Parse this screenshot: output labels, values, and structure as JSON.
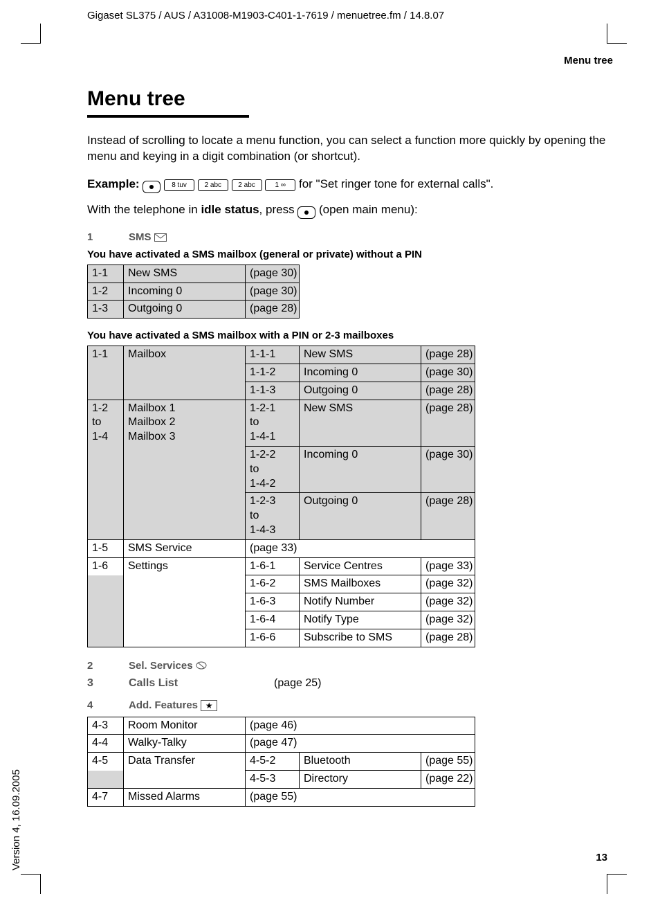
{
  "header": {
    "source_line": "Gigaset SL375 / AUS / A31008-M1903-C401-1-7619 / menuetree.fm / 14.8.07",
    "top_right": "Menu tree",
    "title": "Menu tree"
  },
  "intro": {
    "line1": "Instead of scrolling to locate a menu function, you can select a function more quickly by opening the menu and keying in a digit combination (or shortcut).",
    "example_label": "Example:",
    "key1": "8 tuv",
    "key2": "2 abc",
    "key3": "2 abc",
    "key4": "1 ∞",
    "example_tail": " for \"Set ringer tone for external calls\".",
    "idle_pre": "With the telephone in ",
    "idle_bold": "idle status",
    "idle_post": ", press ",
    "idle_tail": " (open main menu):"
  },
  "sections": {
    "s1": {
      "num": "1",
      "label": "SMS"
    },
    "s2": {
      "num": "2",
      "label": "Sel. Services"
    },
    "s3": {
      "num": "3",
      "label": "Calls List",
      "page": "(page 25)"
    },
    "s4": {
      "num": "4",
      "label": "Add. Features"
    }
  },
  "notes": {
    "no_pin": "You have activated a SMS mailbox (general or private) without a PIN",
    "with_pin": "You have activated a SMS mailbox with a PIN or 2-3 mailboxes"
  },
  "tableA": {
    "r1": {
      "c1": "1-1",
      "c2": "New SMS",
      "c3": "(page 30)"
    },
    "r2": {
      "c1": "1-2",
      "c2": "Incoming 0",
      "c3": "(page 30)"
    },
    "r3": {
      "c1": "1-3",
      "c2": "Outgoing 0",
      "c3": "(page 28)"
    }
  },
  "tableB": {
    "r1": {
      "c1": "1-1",
      "c2": "Mailbox",
      "c3": "1-1-1",
      "c4": "New SMS",
      "c5": "(page 28)"
    },
    "r2": {
      "c3": "1-1-2",
      "c4": "Incoming 0",
      "c5": "(page 30)"
    },
    "r3": {
      "c3": "1-1-3",
      "c4": "Outgoing 0",
      "c5": "(page 28)"
    },
    "r4": {
      "c1a": "1-2",
      "c1b": "to",
      "c1c": "1-4",
      "c2a": "Mailbox 1",
      "c2b": "Mailbox 2",
      "c2c": "Mailbox 3",
      "c3a": "1-2-1",
      "c3b": "to",
      "c3c": "1-4-1",
      "c4": "New SMS",
      "c5": "(page 28)"
    },
    "r5": {
      "c3a": "1-2-2",
      "c3b": "to",
      "c3c": "1-4-2",
      "c4": "Incoming 0",
      "c5": "(page 30)"
    },
    "r6": {
      "c3a": "1-2-3",
      "c3b": "to",
      "c3c": "1-4-3",
      "c4": "Outgoing 0",
      "c5": "(page 28)"
    },
    "r7": {
      "c1": "1-5",
      "c2": "SMS Service",
      "c3": "(page 33)"
    },
    "r8": {
      "c1": "1-6",
      "c2": "Settings",
      "c3": "1-6-1",
      "c4": "Service Centres",
      "c5": "(page 33)"
    },
    "r9": {
      "c3": "1-6-2",
      "c4": "SMS Mailboxes",
      "c5": "(page 32)"
    },
    "r10": {
      "c3": "1-6-3",
      "c4": "Notify Number",
      "c5": "(page 32)"
    },
    "r11": {
      "c3": "1-6-4",
      "c4": "Notify Type",
      "c5": "(page 32)"
    },
    "r12": {
      "c3": "1-6-6",
      "c4": "Subscribe to SMS",
      "c5": "(page 28)"
    }
  },
  "tableC": {
    "r1": {
      "c1": "4-3",
      "c2": "Room Monitor",
      "c3": "(page 46)"
    },
    "r2": {
      "c1": "4-4",
      "c2": "Walky-Talky",
      "c3": "(page 47)"
    },
    "r3": {
      "c1": "4-5",
      "c2": "Data Transfer",
      "c3": "4-5-2",
      "c4": "Bluetooth",
      "c5": "(page 55)"
    },
    "r4": {
      "c3": "4-5-3",
      "c4": "Directory",
      "c5": "(page 22)"
    },
    "r5": {
      "c1": "4-7",
      "c2": "Missed Alarms",
      "c3": "(page 55)"
    }
  },
  "footer": {
    "page_number": "13",
    "version": "Version 4, 16.09.2005"
  }
}
